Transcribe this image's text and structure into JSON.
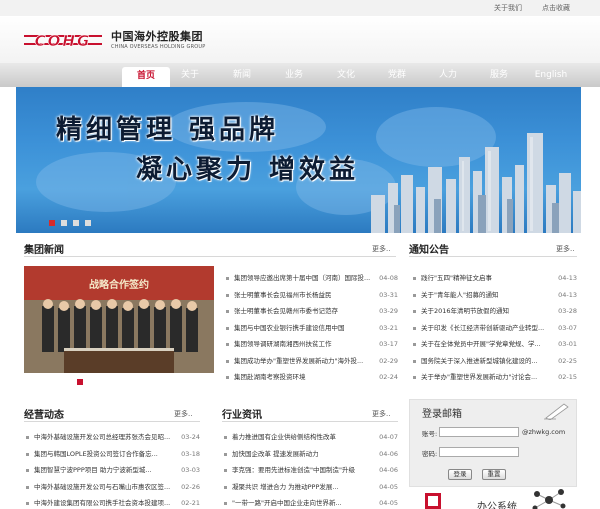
{
  "topbar": {
    "about": "关于我们",
    "favorite": "点击收藏"
  },
  "logo": {
    "mark_text": "COHG",
    "name_cn": "中国海外控股集团",
    "name_en": "CHINA OVERSEAS HOLDING GROUP"
  },
  "nav": [
    "首页",
    "关于",
    "新闻",
    "业务",
    "文化",
    "党群",
    "人力",
    "服务",
    "English"
  ],
  "banner": {
    "slogan1": "精细管理 强品牌",
    "slogan2": "凝心聚力 增效益"
  },
  "group_news": {
    "title": "集团新闻",
    "more": "更多..",
    "photo_banner_text": "战略合作签约",
    "items": [
      {
        "title": "集团领导应邀出席第十届中国（河南）国际投...",
        "date": "04-08"
      },
      {
        "title": "张士明董事长会见福州市长杨益民",
        "date": "03-31"
      },
      {
        "title": "张士明董事长会见赣州市委书记范存",
        "date": "03-29"
      },
      {
        "title": "集团与中国农业银行携手建设信用中国",
        "date": "03-21"
      },
      {
        "title": "集团领导调研湖南湘西州扶贫工作",
        "date": "03-17"
      },
      {
        "title": "集团成功举办\"重塑世界发展新动力\"海外投...",
        "date": "02-29"
      },
      {
        "title": "集团赴湖南考察投资环境",
        "date": "02-24"
      }
    ]
  },
  "notices": {
    "title": "通知公告",
    "more": "更多..",
    "items": [
      {
        "title": "践行\"五四\"精神征文启事",
        "date": "04-13"
      },
      {
        "title": "关于\"青年能人\"招募的通知",
        "date": "04-13"
      },
      {
        "title": "关于2016年清明节放假的通知",
        "date": "03-28"
      },
      {
        "title": "关于印发《长江经济带创新驱动产业转型...",
        "date": "03-07"
      },
      {
        "title": "关于在全体党员中开展\"学党章党规、学...",
        "date": "03-01"
      },
      {
        "title": "国务院关于深入推进新型城镇化建设的...",
        "date": "02-25"
      },
      {
        "title": "关于举办\"重塑世界发展新动力\"讨论会...",
        "date": "02-15"
      }
    ]
  },
  "operations": {
    "title": "经营动态",
    "more": "更多..",
    "items": [
      {
        "title": "中海外基础设施开发公司总经理苏张杰会见昭...",
        "date": "03-24"
      },
      {
        "title": "集团与韩国LOPLE投资公司签订合作备忘...",
        "date": "03-18"
      },
      {
        "title": "集团智慧宁波PPP项目 助力宁波新型城...",
        "date": "03-03"
      },
      {
        "title": "中海外基础设施开发公司与石嘴山市惠农区签...",
        "date": "02-26"
      },
      {
        "title": "中海外建设集团有限公司携手社会资本投建项...",
        "date": "02-21"
      }
    ]
  },
  "industry": {
    "title": "行业资讯",
    "more": "更多..",
    "items": [
      {
        "title": "着力推进国有企业供给侧结构性改革",
        "date": "04-07"
      },
      {
        "title": "加快国企改革 提速发展新动力",
        "date": "04-06"
      },
      {
        "title": "李克强：要用先进标准创造\"中国制造\"升级",
        "date": "04-06"
      },
      {
        "title": "凝聚共识 增进合力 为推动PPP发展...",
        "date": "04-05"
      },
      {
        "title": "\"一带一路\"开启中国企业走向世界新...",
        "date": "04-05"
      }
    ]
  },
  "login": {
    "title": "登录邮箱",
    "account_label": "账号:",
    "password_label": "密码:",
    "domain": "@zhwkg.com",
    "login_button": "登录",
    "reset_button": "重置"
  },
  "office": {
    "label": "办公系统"
  },
  "colors": {
    "brand_red": "#c8102e",
    "banner_blue": "#3d92d8"
  }
}
